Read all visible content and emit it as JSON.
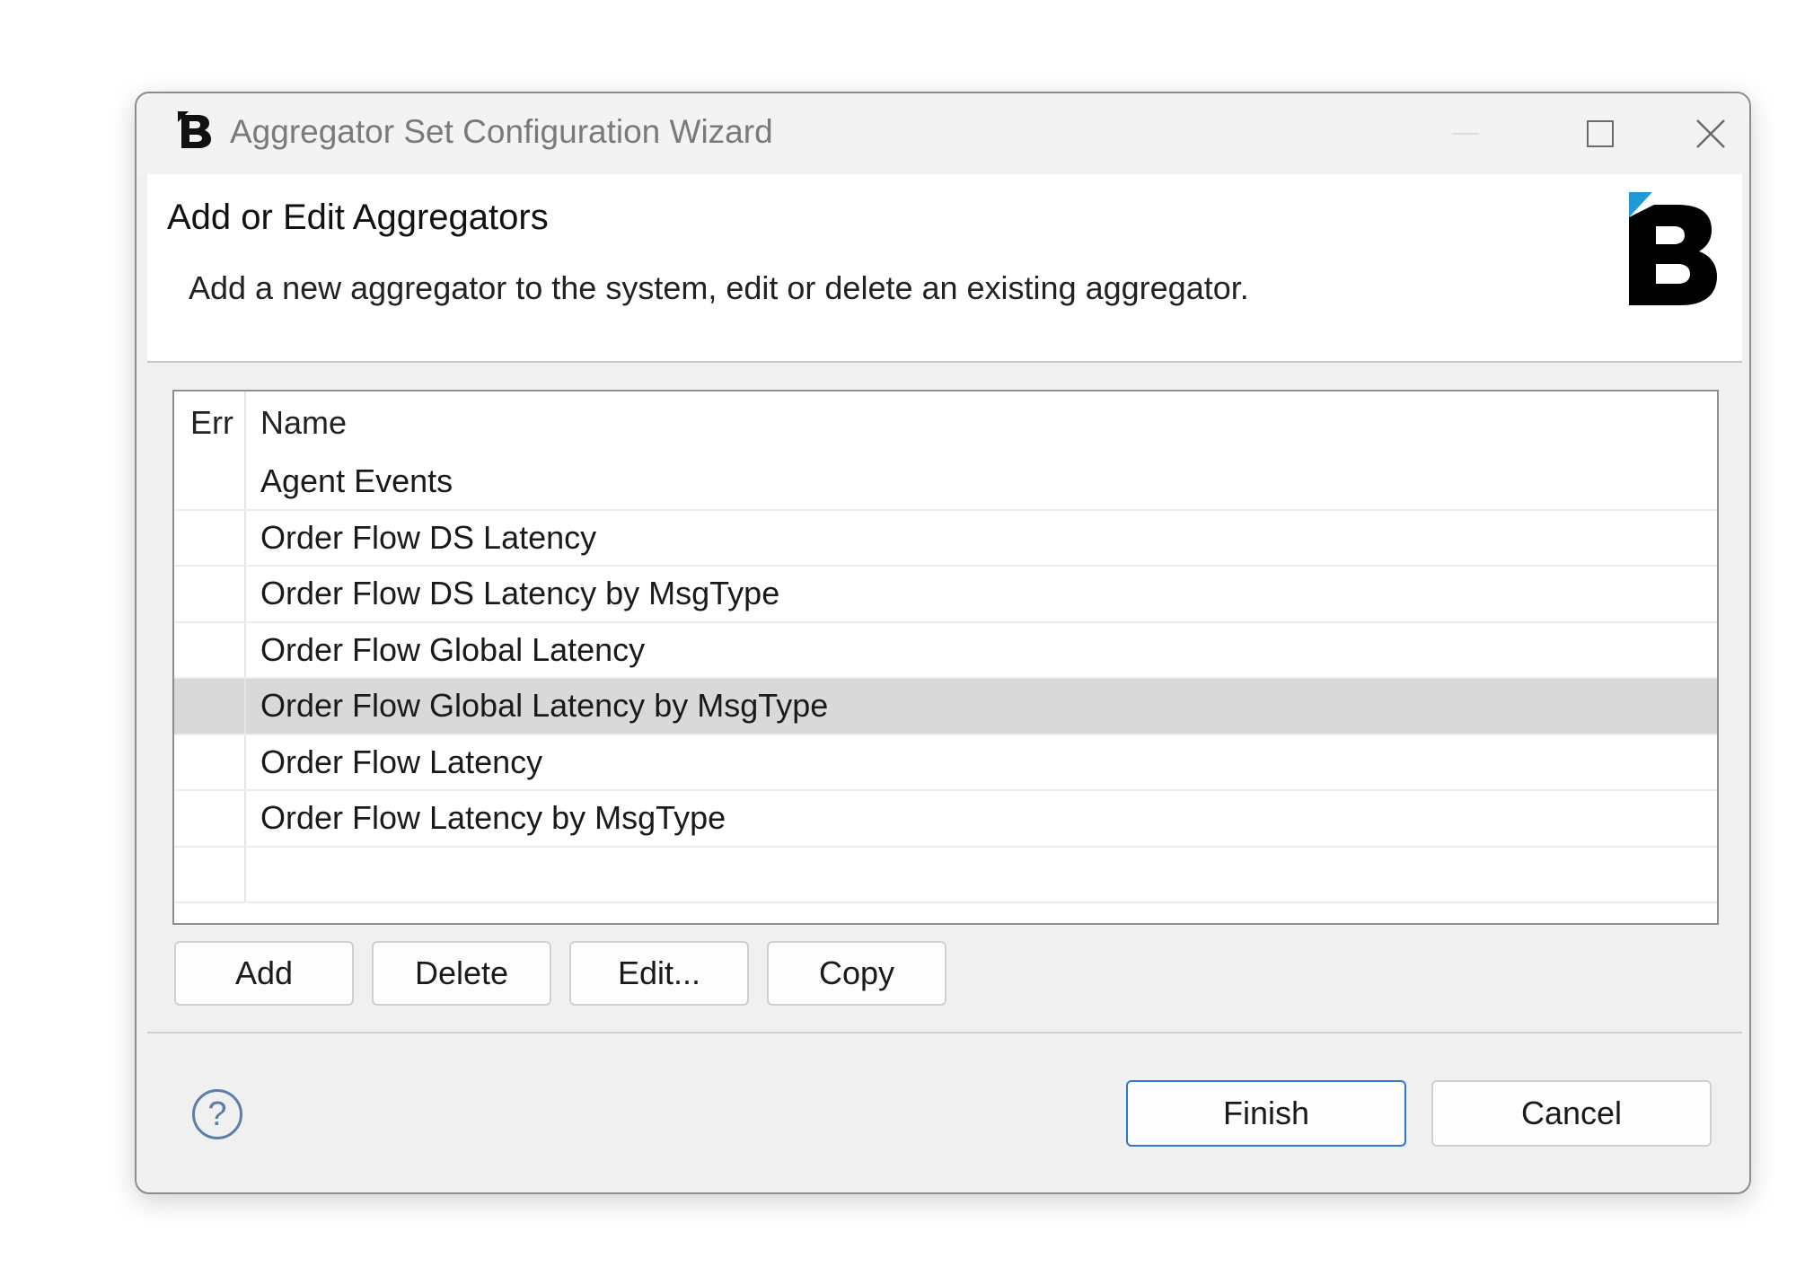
{
  "window": {
    "title": "Aggregator Set Configuration Wizard",
    "app_icon": "b-logo-icon"
  },
  "header": {
    "title": "Add or Edit Aggregators",
    "description": "Add a new aggregator to the system, edit or delete an existing aggregator.",
    "logo_icon": "b-brand-logo-icon"
  },
  "table": {
    "columns": [
      "Err",
      "Name"
    ],
    "rows": [
      {
        "err": "",
        "name": "Agent Events"
      },
      {
        "err": "",
        "name": "Order Flow DS Latency"
      },
      {
        "err": "",
        "name": "Order Flow DS Latency by MsgType"
      },
      {
        "err": "",
        "name": "Order Flow Global Latency"
      },
      {
        "err": "",
        "name": "Order Flow Global Latency by MsgType",
        "selected": true
      },
      {
        "err": "",
        "name": "Order Flow Latency"
      },
      {
        "err": "",
        "name": "Order Flow Latency by MsgType"
      },
      {
        "err": "",
        "name": ""
      }
    ]
  },
  "actions": {
    "add": "Add",
    "delete": "Delete",
    "edit": "Edit...",
    "copy": "Copy"
  },
  "footer": {
    "help": "?",
    "finish": "Finish",
    "cancel": "Cancel"
  },
  "colors": {
    "selected_row": "#d9d9d9",
    "default_button_border": "#2a78d4",
    "logo_accent": "#1f9ad6"
  }
}
